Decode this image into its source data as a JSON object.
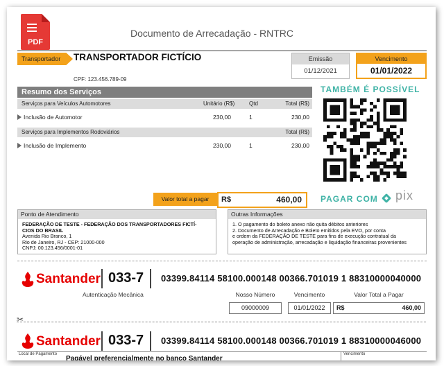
{
  "header": {
    "pdf_label": "PDF",
    "title": "Documento de Arrecadação - RNTRC"
  },
  "transportador": {
    "tag": "Transportador",
    "name": "TRANSPORTADOR FICTÍCIO",
    "cpf": "CPF: 123.456.789-09"
  },
  "emissao": {
    "label": "Emissão",
    "value": "01/12/2021"
  },
  "vencimento": {
    "label": "Vencimento",
    "value": "01/01/2022"
  },
  "resumo": {
    "title": "Resumo dos Serviços",
    "section1": {
      "title": "Serviços para Veículos Automotores",
      "col_unit": "Unitário (R$)",
      "col_qtd": "Qtd",
      "col_total": "Total (R$)"
    },
    "item1": {
      "name": "Inclusão de Automotor",
      "unit": "230,00",
      "qtd": "1",
      "total": "230,00"
    },
    "section2": {
      "title": "Serviços para Implementos Rodoviários",
      "col_total": "Total (R$)"
    },
    "item2": {
      "name": "Inclusão de Implemento",
      "unit": "230,00",
      "qtd": "1",
      "total": "230,00"
    }
  },
  "total": {
    "label": "Valor total a pagar",
    "currency": "R$",
    "value": "460,00"
  },
  "pix": {
    "tambem": "TAMBÉM É POSSÍVEL",
    "pagar": "PAGAR COM",
    "logo": "pix",
    "colors": {
      "accent": "#3fb3a6",
      "orange": "#f3a21b"
    }
  },
  "ponto": {
    "title": "Ponto de Atendimento",
    "line1": "FEDERAÇÃO DE TESTE - FEDERAÇÃO DOS TRANSPORTADORES FICTÍ-",
    "line2": "CIOS DO BRASIL",
    "line3": "Avenida Rio Branco, 1",
    "line4": "Rio de Janeiro, RJ - CEP: 21000-000",
    "line5": "CNPJ: 00.123.456/0001-01"
  },
  "outras": {
    "title": "Outras Informações",
    "line1": "1. O pagamento do boleto anexo não quita débitos anteriores",
    "line2": "2. Documento de Arrecadação e Boleto emitidos pela EVO, por conta",
    "line3": "e ordem da FEDERAÇÃO DE TESTE para fins de execução contratual da",
    "line4": "operação de administração, arrecadação e liquidação financeiras provenientes"
  },
  "boleto1": {
    "bank": "Santander",
    "code": "033-7",
    "linha": "03399.84114 58100.000148 00366.701019 1 88310000040000",
    "autenticacao": "Autenticação Mecânica",
    "nosso_numero_label": "Nosso Número",
    "nosso_numero": "09000009",
    "vencimento_label": "Vencimento",
    "vencimento": "01/01/2022",
    "valor_label": "Valor Total a Pagar",
    "valor_currency": "R$",
    "valor": "460,00"
  },
  "boleto2": {
    "bank": "Santander",
    "code": "033-7",
    "linha": "03399.84114 58100.000148 00366.701019 1 88310000046000",
    "local_label": "Local de Pagamento",
    "local_value": "Pagável preferencialmente no banco Santander",
    "venc_label": "Vencimento"
  }
}
